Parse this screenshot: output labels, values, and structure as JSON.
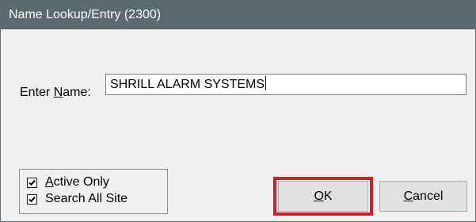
{
  "window": {
    "title": "Name Lookup/Entry (2300)"
  },
  "name_field": {
    "label_prefix": "Enter ",
    "label_mnemonic": "N",
    "label_suffix": "ame:",
    "value": "SHRILL ALARM SYSTEMS"
  },
  "checkboxes": [
    {
      "label_mnemonic": "A",
      "label_rest": "ctive Only",
      "checked": true
    },
    {
      "label_rest": "Search All Site",
      "checked": true
    }
  ],
  "buttons": {
    "ok": {
      "label_mnemonic": "O",
      "label_rest": "K",
      "highlight_color": "#cf1f2b"
    },
    "cancel": {
      "label_mnemonic": "C",
      "label_rest": "ancel"
    }
  }
}
